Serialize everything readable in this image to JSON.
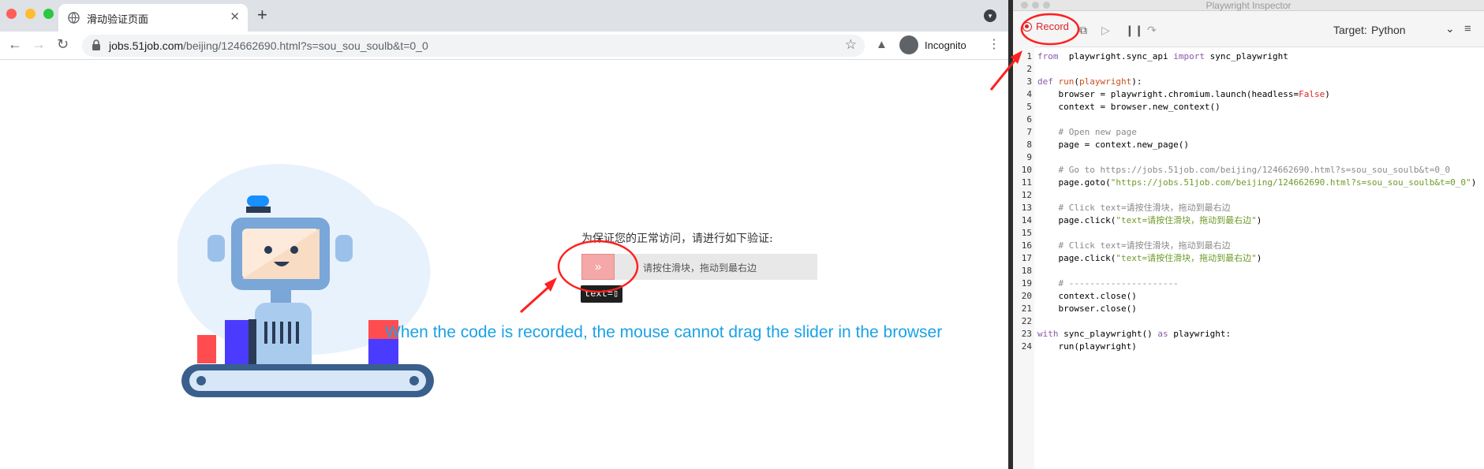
{
  "browser": {
    "tab_title": "滑动验证页面",
    "tab_close": "✕",
    "new_tab": "+",
    "url_host": "jobs.51job.com",
    "url_path": "/beijing/124662690.html?s=sou_sou_soulb&t=0_0",
    "incognito_label": "Incognito"
  },
  "page": {
    "verify_title": "为保证您的正常访问，请进行如下验证:",
    "slider_handle": "»",
    "slider_text": "请按住滑块，拖动到最右边",
    "tooltip": "text=▯",
    "annotation": "When the code is recorded, the mouse cannot drag the slider in the browser"
  },
  "inspector": {
    "window_title": "Playwright Inspector",
    "record_label": "Record",
    "target_label": "Target:",
    "target_value": "Python"
  },
  "code_lines": [
    {
      "n": "1",
      "parts": [
        [
          "kw",
          "from"
        ],
        [
          "",
          "  playwright.sync_api "
        ],
        [
          "kw",
          "import"
        ],
        [
          "",
          " sync_playwright"
        ]
      ]
    },
    {
      "n": "2",
      "parts": []
    },
    {
      "n": "3",
      "parts": [
        [
          "kw",
          "def"
        ],
        [
          "",
          " "
        ],
        [
          "fn",
          "run"
        ],
        [
          "",
          "("
        ],
        [
          "fn",
          "playwright"
        ],
        [
          "",
          "):"
        ]
      ]
    },
    {
      "n": "4",
      "parts": [
        [
          "",
          "    browser = playwright.chromium.launch(headless="
        ],
        [
          "bool",
          "False"
        ],
        [
          "",
          ")"
        ]
      ]
    },
    {
      "n": "5",
      "parts": [
        [
          "",
          "    context = browser.new_context()"
        ]
      ]
    },
    {
      "n": "6",
      "parts": []
    },
    {
      "n": "7",
      "parts": [
        [
          "cm",
          "    # Open new page"
        ]
      ]
    },
    {
      "n": "8",
      "parts": [
        [
          "",
          "    page = context.new_page()"
        ]
      ]
    },
    {
      "n": "9",
      "parts": []
    },
    {
      "n": "10",
      "parts": [
        [
          "cm",
          "    # Go to https://jobs.51job.com/beijing/124662690.html?s=sou_sou_soulb&t=0_0"
        ]
      ]
    },
    {
      "n": "11",
      "parts": [
        [
          "",
          "    page.goto("
        ],
        [
          "str",
          "\"https://jobs.51job.com/beijing/124662690.html?s=sou_sou_soulb&t=0_0\""
        ],
        [
          "",
          ")"
        ]
      ]
    },
    {
      "n": "12",
      "parts": []
    },
    {
      "n": "13",
      "parts": [
        [
          "cm",
          "    # Click text=请按住滑块，拖动到最右边"
        ]
      ]
    },
    {
      "n": "14",
      "parts": [
        [
          "",
          "    page.click("
        ],
        [
          "str",
          "\"text=请按住滑块，拖动到最右边\""
        ],
        [
          "",
          ")"
        ]
      ]
    },
    {
      "n": "15",
      "parts": []
    },
    {
      "n": "16",
      "parts": [
        [
          "cm",
          "    # Click text=请按住滑块，拖动到最右边"
        ]
      ]
    },
    {
      "n": "17",
      "parts": [
        [
          "",
          "    page.click("
        ],
        [
          "str",
          "\"text=请按住滑块，拖动到最右边\""
        ],
        [
          "",
          ")"
        ]
      ]
    },
    {
      "n": "18",
      "parts": []
    },
    {
      "n": "19",
      "parts": [
        [
          "cm",
          "    # ---------------------"
        ]
      ]
    },
    {
      "n": "20",
      "parts": [
        [
          "",
          "    context.close()"
        ]
      ]
    },
    {
      "n": "21",
      "parts": [
        [
          "",
          "    browser.close()"
        ]
      ]
    },
    {
      "n": "22",
      "parts": []
    },
    {
      "n": "23",
      "parts": [
        [
          "kw",
          "with"
        ],
        [
          "",
          " sync_playwright() "
        ],
        [
          "kw",
          "as"
        ],
        [
          "",
          " playwright:"
        ]
      ]
    },
    {
      "n": "24",
      "parts": [
        [
          "",
          "    run(playwright)"
        ]
      ]
    }
  ]
}
